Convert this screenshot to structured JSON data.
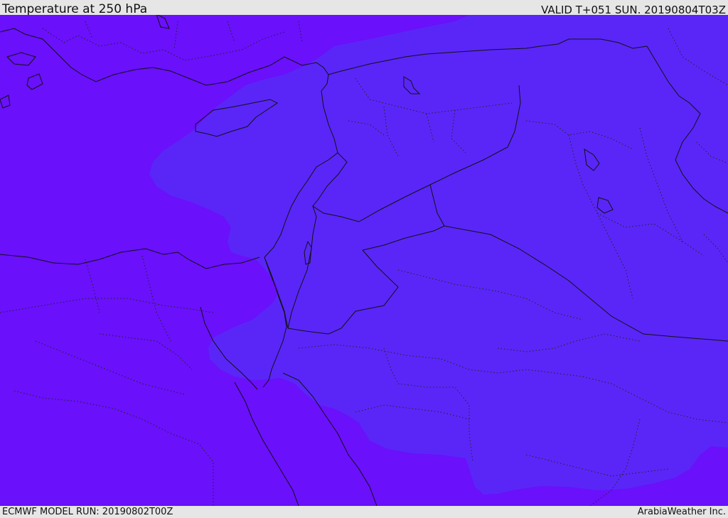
{
  "header": {
    "title": "Temperature at 250 hPa",
    "valid": "VALID T+051 SUN. 20190804T03Z"
  },
  "footer": {
    "model_run": "ECMWF MODEL RUN: 20190802T00Z",
    "credit": "ArabiaWeather Inc."
  },
  "colors": {
    "cold_band": "#6a10fb",
    "warm_band": "#5a26f7",
    "lines": "#111111",
    "bars": "#e6e6e6"
  }
}
